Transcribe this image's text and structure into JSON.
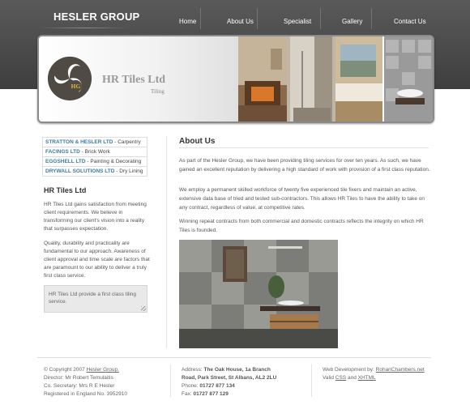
{
  "header": {
    "logo": "HESLER GROUP"
  },
  "nav": {
    "items": [
      "Home",
      "About Us",
      "Specialist",
      "Gallery",
      "Contact Us"
    ]
  },
  "banner": {
    "brand": "HR Tiles Ltd",
    "sub": "Tiling",
    "emblem_text": "HG"
  },
  "companies": [
    {
      "name": "STRATTON & HESLER LTD",
      "desc": " - Carpentry"
    },
    {
      "name": "FACINGS LTD",
      "desc": " - Brick Work"
    },
    {
      "name": "EGGSHELL LTD",
      "desc": " - Painting & Decorating"
    },
    {
      "name": "DRYWALL SOLUTIONS LTD",
      "desc": " - Dry Lining"
    }
  ],
  "sidebar": {
    "title": "HR Tiles Ltd",
    "p1": "HR Tiles Ltd gains satisfaction from meeting client requirements. We believe in transforming our client's vision into a reality that surpasses expectation.",
    "p2": "Quality, durability and practicality are fundamental to our approach. Awareness of client approval and time scale are factors that are paramount to our ability to deliver a truly first class service.",
    "quote": "HR Tiles Ltd provide a first class tiling service."
  },
  "main": {
    "title": "About Us",
    "p1": "As part of the Hesler Group, we have been providing tiling services for over ten years. As such, we have gained an excellent reputation by delivering a high standard of work with provision of a first class reputation.",
    "p2": "We employ a permanent skilled workforce of twenty five experienced tile fixers and maintain an active, extensive data base of tried and tested sub-contractors. This allows HR Tiles to have the ability to take on any contract, regardless of value, at competitive rates.",
    "p3": "Winning repeat contracts from both commercial and domestic contracts reflects the integrity on which HR Tiles is founded."
  },
  "footer": {
    "copyright_prefix": "© Copyright 2007 ",
    "copyright_link": "Hesler Group.",
    "director": "Director: Mr Robert Temulaitis",
    "secretary": "Co. Secretary: Mrs R E Hesler",
    "registered": "Registered in England No. 3952910",
    "address_label": "Address: ",
    "address_1": "The Oak House, 1a Branch",
    "address_2": "Road, Park Street, St Albans, AL2 2LU",
    "phone_label": "Phone: ",
    "phone": "01727 877 134",
    "fax_label": "Fax: ",
    "fax": "01727 877 129",
    "webdev_label": "Web Development by: ",
    "webdev_link": "RohanChambers.net",
    "valid_prefix": "Valid ",
    "css_link": "CSS",
    "and": " and ",
    "xhtml_link": "XHTML"
  },
  "colors": {
    "header_bg": "#4a4a4a",
    "accent": "#3a7d9a",
    "quote_bg": "#e9e9e9"
  },
  "icons": [
    "triskelion-emblem-icon",
    "resize-grip-icon"
  ]
}
